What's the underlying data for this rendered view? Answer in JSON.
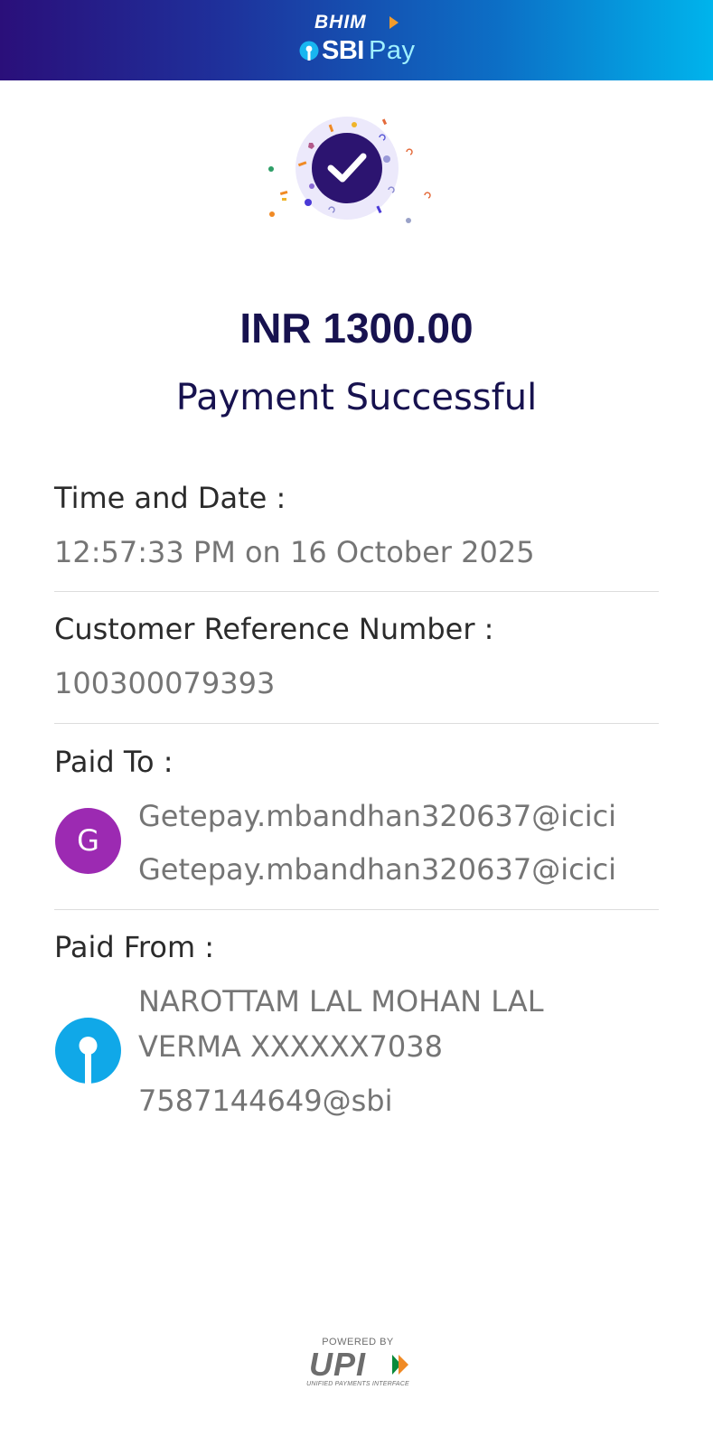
{
  "header": {
    "bhim_label": "BHIM",
    "sbi_label": "SBI",
    "pay_label": "Pay"
  },
  "transaction": {
    "amount": "INR 1300.00",
    "status": "Payment Successful"
  },
  "details": {
    "time_label": "Time and Date :",
    "time_value": "12:57:33 PM on 16 October 2025",
    "ref_label": "Customer Reference Number :",
    "ref_value": "100300079393",
    "paid_to_label": "Paid To :",
    "paid_to_initial": "G",
    "paid_to_name": "Getepay.mbandhan320637@icici",
    "paid_to_vpa": "Getepay.mbandhan320637@icici",
    "paid_from_label": "Paid From :",
    "paid_from_name_line1": "NAROTTAM LAL MOHAN LAL",
    "paid_from_name_line2": "VERMA XXXXXX7038",
    "paid_from_vpa": "7587144649@sbi"
  },
  "footer": {
    "powered_by": "POWERED BY",
    "upi_label": "UPI",
    "upi_full": "UNIFIED PAYMENTS INTERFACE"
  },
  "colors": {
    "header_gradient_start": "#2a0f7a",
    "header_gradient_end": "#00b4ec",
    "accent_dark": "#17124f",
    "paid_to_avatar": "#9c2ab2",
    "paid_from_avatar": "#10a8e8"
  },
  "icons": {
    "success": "check-circle-icon",
    "bank": "sbi-keyhole-icon"
  }
}
